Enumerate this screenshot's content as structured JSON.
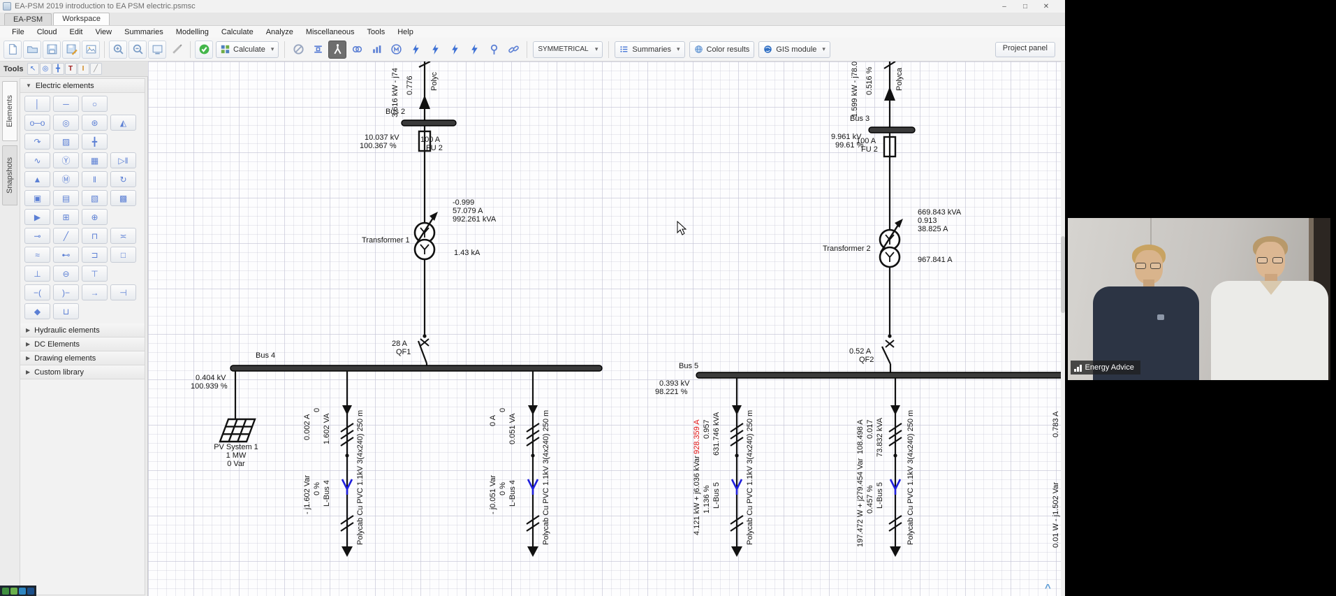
{
  "window": {
    "title": "EA-PSM 2019 introduction to EA PSM electric.psmsc",
    "min": "–",
    "max": "□",
    "close": "✕"
  },
  "tabs": [
    "EA-PSM",
    "Workspace"
  ],
  "menu": [
    "File",
    "Cloud",
    "Edit",
    "View",
    "Summaries",
    "Modelling",
    "Calculate",
    "Analyze",
    "Miscellaneous",
    "Tools",
    "Help"
  ],
  "toolbar": {
    "calculate": "Calculate",
    "symmetrical": "SYMMETRICAL",
    "summaries": "Summaries",
    "color_results": "Color results",
    "gis_module": "GIS module",
    "project_panel": "Project panel",
    "arrow": "▾"
  },
  "sidebar": {
    "tools_label": "Tools",
    "mini": [
      "↖",
      "◎",
      "╋",
      "T",
      "I",
      "╱"
    ],
    "tabs": [
      "Elements",
      "Snapshots"
    ],
    "sections": {
      "electric": "Electric elements",
      "hydraulic": "Hydraulic elements",
      "dc": "DC Elements",
      "drawing": "Drawing elements",
      "custom": "Custom library"
    },
    "palette": [
      "│",
      "─",
      "○",
      "o─o",
      "◎",
      "⊛",
      "◭",
      "↷",
      "▨",
      "╋",
      "∿",
      "Ⓨ",
      "▦",
      "▷‖",
      "▲",
      "Ⓜ",
      "‖",
      "↻",
      "▣",
      "▤",
      "▧",
      "▩",
      "▶",
      "⊞",
      "⊕",
      "⊸",
      "╱",
      "⊓",
      "≍",
      "≈",
      "⊷",
      "⊐",
      "□",
      "⊥",
      "⊖",
      "⊤",
      "−(",
      ")−",
      "→",
      "⊣",
      "◆",
      "⊔"
    ]
  },
  "diagram": {
    "left": {
      "flow_top": "3.616 kW - j74",
      "pct_top": "0.776",
      "cable_top": "Polyc",
      "bus2": {
        "name": "Bus 2",
        "kv": "10.037 kV",
        "pct": "100.367 %",
        "amp": "100 A",
        "fuse": "FU 2"
      },
      "t1": {
        "name": "Transformer 1",
        "pf": "-0.999",
        "amp": "57.079 A",
        "kva": "992.261 kVA",
        "ka": "1.43 kA"
      },
      "qf1": {
        "amp": "28 A",
        "name": "QF1"
      },
      "bus4": {
        "name": "Bus 4",
        "kv": "0.404 kV",
        "pct": "100.939 %"
      },
      "pv": {
        "name": "PV System 1",
        "p": "1 MW",
        "q": "0 Var"
      },
      "f1": {
        "i": "0.002 A",
        "z": "0",
        "s": "1.602 VA",
        "q": "- j1.602 Var",
        "pct": "0 %",
        "load": "L-Bus 4",
        "cable": "Polycab Cu PVC 1.1kV 3(4x240) 250 m"
      },
      "f2": {
        "i": "0 A",
        "z": "0",
        "s": "0.051 VA",
        "q": "- j0.051 Var",
        "pct": "0 %",
        "load": "L-Bus 4",
        "cable": "Polycab Cu PVC 1.1kV 3(4x240) 250 m"
      }
    },
    "right": {
      "flow_top": "1.599 kW - j78.0",
      "pct_top": "0.516 %",
      "cable_top": "Polyca",
      "bus3": {
        "name": "Bus 3",
        "kv": "9.961 kV",
        "pct": "99.61 %",
        "amp": "100 A",
        "fuse": "FU 2"
      },
      "t2": {
        "name": "Transformer 2",
        "kva": "669.843 kVA",
        "pf": "0.913",
        "amp": "38.825 A",
        "amp2": "967.841 A"
      },
      "qf2": {
        "amp": "0.52 A",
        "name": "QF2"
      },
      "bus5": {
        "name": "Bus 5",
        "kv": "0.393 kV",
        "pct": "98.221 %"
      },
      "f3": {
        "i": "928.359 A",
        "pf": "0.957",
        "s": "631.746 kVA",
        "pq": "4.121 kW + j6.036 kVar",
        "pct": "1.136 %",
        "load": "L-Bus 5",
        "cable": "Polycab Cu PVC 1.1kV 3(4x240) 250 m"
      },
      "f4": {
        "i": "108.498 A",
        "pf": "0.017",
        "s": "73.832 kVA",
        "pq": "197.472 W + j279.454 Var",
        "pct": "0.457 %",
        "load": "L-Bus 5",
        "cable": "Polycab Cu PVC 1.1kV 3(4x240) 250 m"
      },
      "edge": {
        "i": "0.783 A",
        "pq": "0.01 W - j1.502 Var"
      }
    }
  },
  "statusbar": {
    "caret": "^"
  },
  "webcam": {
    "label": "Energy Advice"
  },
  "colors": {
    "accent_blue": "#5b7fd4",
    "flow_arrow_blue": "#2020dd",
    "alert_red": "#e01212",
    "check_green": "#43b64b"
  }
}
